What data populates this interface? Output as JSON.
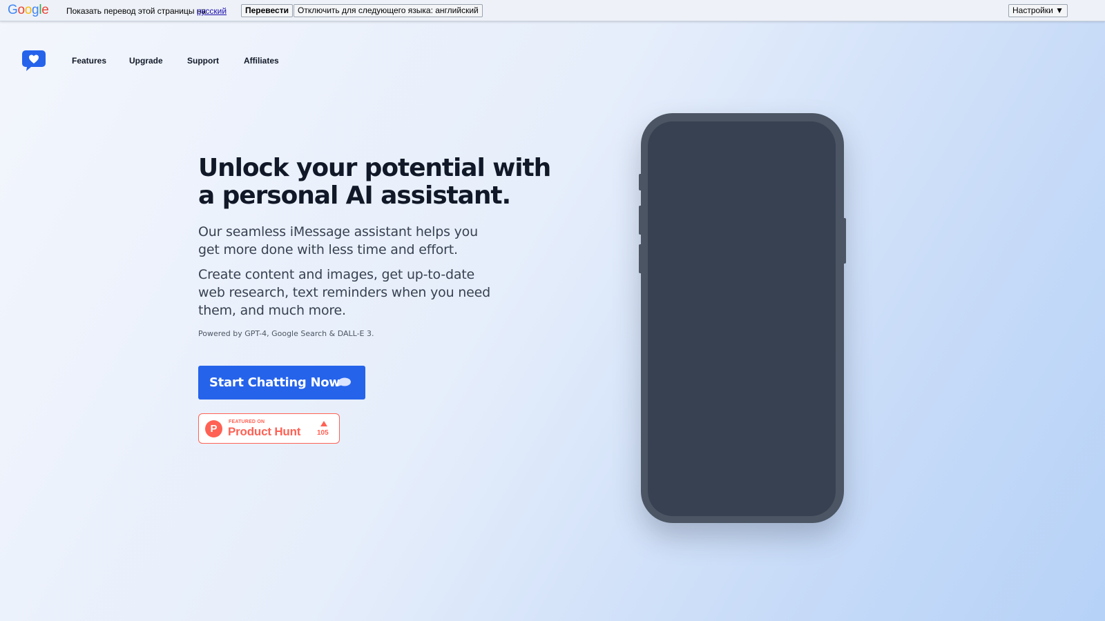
{
  "translate_bar": {
    "logo_text": "Google",
    "prompt": "Показать перевод этой страницы на",
    "language_link": "русский",
    "translate_button": "Перевести",
    "disable_button": "Отключить для следующего языка: английский",
    "settings_button": "Настройки ▼"
  },
  "site": {
    "logo_icon": "chat-heart-icon",
    "nav": [
      {
        "label": "Features"
      },
      {
        "label": "Upgrade"
      },
      {
        "label": "Support"
      },
      {
        "label": "Affiliates"
      }
    ]
  },
  "hero": {
    "title": "Unlock your potential with a personal AI assistant.",
    "paragraph1": "Our seamless iMessage assistant helps you get more done with less time and effort.",
    "paragraph2": "Create content and images, get up-to-date web research, text reminders when you need them, and much more.",
    "powered_by": "Powered by GPT-4, Google Search & DALL-E 3.",
    "cta_label": "Start Chatting Now",
    "cta_icon": "chat-bubble-icon"
  },
  "product_hunt": {
    "logo_letter": "P",
    "featured_on": "FEATURED ON",
    "name": "Product Hunt",
    "upvotes": "105",
    "icon": "upvote-arrow-icon"
  },
  "colors": {
    "accent": "#2563eb",
    "product_hunt": "#ff6154",
    "phone_frame": "#4b5563",
    "phone_screen": "#374151"
  }
}
